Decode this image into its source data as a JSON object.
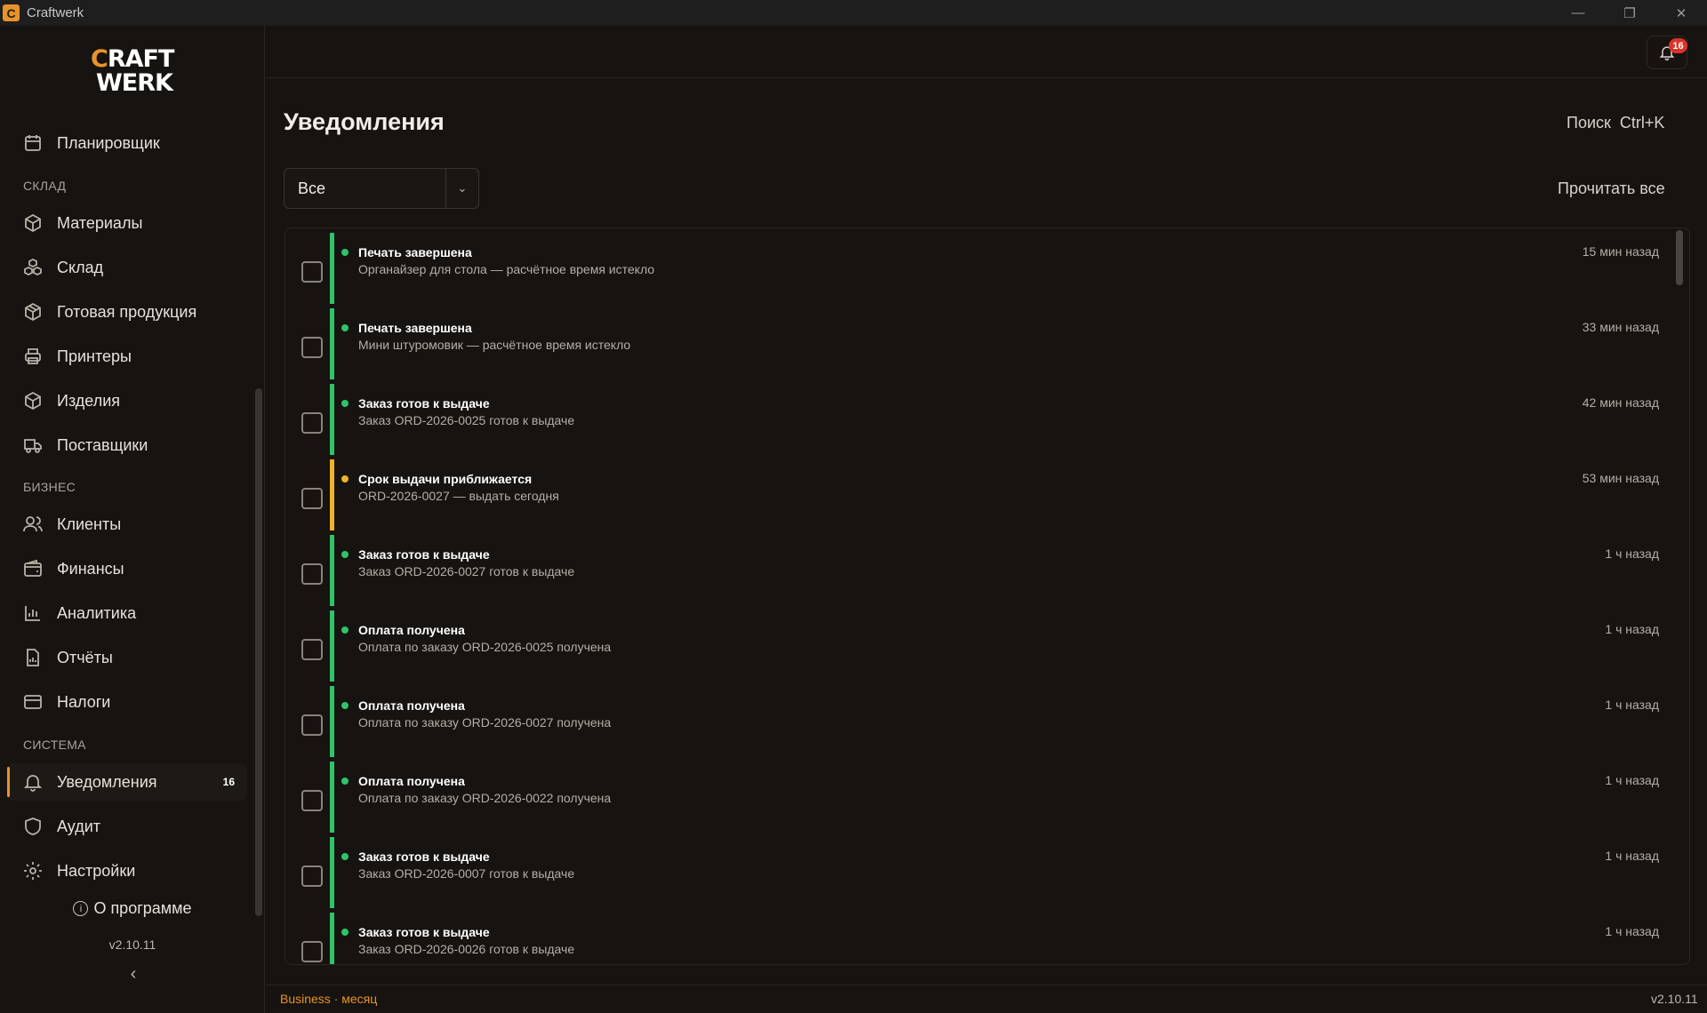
{
  "window": {
    "title": "Craftwerk"
  },
  "sidebar": {
    "logo": {
      "line1_letter": "C",
      "line1_rest": "RAFT",
      "line2": "WERK"
    },
    "planner": "Планировщик",
    "sections": {
      "warehouse": "СКЛАД",
      "business": "БИЗНЕС",
      "system": "СИСТЕМА"
    },
    "items": {
      "materials": "Материалы",
      "warehouse": "Склад",
      "finished": "Готовая продукция",
      "printers": "Принтеры",
      "products": "Изделия",
      "suppliers": "Поставщики",
      "clients": "Клиенты",
      "finance": "Финансы",
      "analytics": "Аналитика",
      "reports": "Отчёты",
      "taxes": "Налоги",
      "notifications": "Уведомления",
      "notifications_badge": "16",
      "audit": "Аудит",
      "settings": "Настройки"
    },
    "about": "О программе",
    "version": "v2.10.11",
    "collapse": "‹"
  },
  "header": {
    "bell_badge": "16"
  },
  "main": {
    "title": "Уведомления",
    "search_hint": "Поиск  Ctrl+K",
    "filter_value": "Все",
    "read_all": "Прочитать все"
  },
  "notifications": [
    {
      "title": "Печать завершена",
      "sub": "Органайзер для стола — расчётное время истекло",
      "time": "15 мин назад",
      "kind": "success"
    },
    {
      "title": "Печать завершена",
      "sub": "Мини штуромовик — расчётное время истекло",
      "time": "33 мин назад",
      "kind": "success"
    },
    {
      "title": "Заказ готов к выдаче",
      "sub": "Заказ ORD-2026-0025 готов к выдаче",
      "time": "42 мин назад",
      "kind": "success"
    },
    {
      "title": "Срок выдачи приближается",
      "sub": "ORD-2026-0027 — выдать сегодня",
      "time": "53 мин назад",
      "kind": "warn"
    },
    {
      "title": "Заказ готов к выдаче",
      "sub": "Заказ ORD-2026-0027 готов к выдаче",
      "time": "1 ч назад",
      "kind": "success"
    },
    {
      "title": "Оплата получена",
      "sub": "Оплата по заказу ORD-2026-0025 получена",
      "time": "1 ч назад",
      "kind": "success"
    },
    {
      "title": "Оплата получена",
      "sub": "Оплата по заказу ORD-2026-0027 получена",
      "time": "1 ч назад",
      "kind": "success"
    },
    {
      "title": "Оплата получена",
      "sub": "Оплата по заказу ORD-2026-0022 получена",
      "time": "1 ч назад",
      "kind": "success"
    },
    {
      "title": "Заказ готов к выдаче",
      "sub": "Заказ ORD-2026-0007 готов к выдаче",
      "time": "1 ч назад",
      "kind": "success"
    },
    {
      "title": "Заказ готов к выдаче",
      "sub": "Заказ ORD-2026-0026 готов к выдаче",
      "time": "1 ч назад",
      "kind": "success"
    }
  ],
  "footer": {
    "plan": "Business · месяц",
    "version": "v2.10.11"
  },
  "colors": {
    "accent": "#e8932a",
    "success": "#2ec46a",
    "warning": "#f0b429",
    "badge": "#d9342b"
  }
}
